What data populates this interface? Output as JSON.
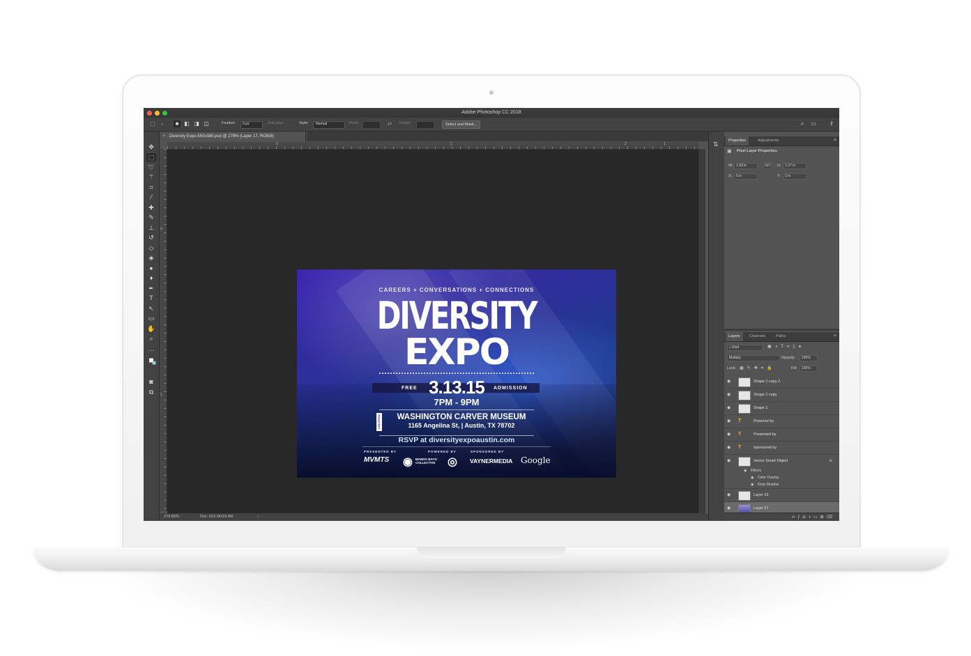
{
  "app": {
    "window_title": "Adobe Photoshop CC 2018"
  },
  "options_bar": {
    "feather_label": "Feather:",
    "feather_value": "0 px",
    "anti_alias_label": "Anti-alias",
    "style_label": "Style:",
    "style_value": "Normal",
    "width_label": "Width:",
    "height_label": "Height:",
    "select_mask_label": "Select and Mask..."
  },
  "document": {
    "tab_title": "Diversity Expo-550x380.psd @ 279% (Layer 17, RGB/8)",
    "ruler_top_labels": [
      "0",
      "1",
      "2",
      "1"
    ],
    "ruler_left_labels": [
      "0",
      "1"
    ],
    "zoom_status": "279.89%",
    "doc_status": "Doc: 612.3K/19.4M"
  },
  "artwork": {
    "tagline": "CAREERS + CONVERSATIONS + CONNECTIONS",
    "title_line1": "DIVERSITY",
    "title_line2": "EXPO",
    "free": "FREE",
    "date": "3.13.15",
    "admission": "ADMISSION",
    "time": "7PM - 9PM",
    "location_tag": "LOCATION",
    "venue": "WASHINGTON CARVER MUSEUM",
    "address": "1165 Angelina St, | Austin, TX 78702",
    "rsvp": "RSVP at diversityexpoaustin.com",
    "presented_by": "PRESENTED BY",
    "powered_by": "POWERED BY",
    "sponsored_by": "SPONSORED BY",
    "logo_mvmts": "MVMTS",
    "logo_mando": "MANDO BAYO COLLECTIVE",
    "logo_vayner": "VAYNERMEDIA",
    "logo_google": "Google"
  },
  "properties_panel": {
    "tab_properties": "Properties",
    "tab_adjustments": "Adjustments",
    "section_title": "Pixel Layer Properties",
    "w_label": "W:",
    "w_value": "1.83 in",
    "link_label": "GO",
    "h_label": "H:",
    "h_value": "1.27 in",
    "x_label": "X:",
    "x_value": "0 in",
    "y_label": "Y:",
    "y_value": "0 in"
  },
  "layers_panel": {
    "tab_layers": "Layers",
    "tab_channels": "Channels",
    "tab_paths": "Paths",
    "filter_kind": "Kind",
    "blend_mode": "Multiply",
    "opacity_label": "Opacity:",
    "opacity_value": "100%",
    "lock_label": "Lock:",
    "fill_label": "Fill:",
    "fill_value": "100%",
    "layers": [
      {
        "name": "Shape 1 copy 2",
        "kind": "shape"
      },
      {
        "name": "Shape 1 copy",
        "kind": "shape"
      },
      {
        "name": "Shape 1",
        "kind": "shape"
      },
      {
        "name": "Powered by",
        "kind": "text"
      },
      {
        "name": "Presented by",
        "kind": "text"
      },
      {
        "name": "sponsored by",
        "kind": "text"
      },
      {
        "name": "Vector Smart Object",
        "kind": "smart",
        "fx": "fx"
      },
      {
        "name": "Layer 16",
        "kind": "pixel"
      },
      {
        "name": "Layer 17",
        "kind": "image",
        "selected": true
      }
    ],
    "effects_label": "Effects",
    "effect_1": "Color Overlay",
    "effect_2": "Drop Shadow"
  },
  "colors": {
    "ui_dark": "#535353",
    "canvas_bg": "#282828",
    "accent_text_layer": "#f0c000"
  }
}
